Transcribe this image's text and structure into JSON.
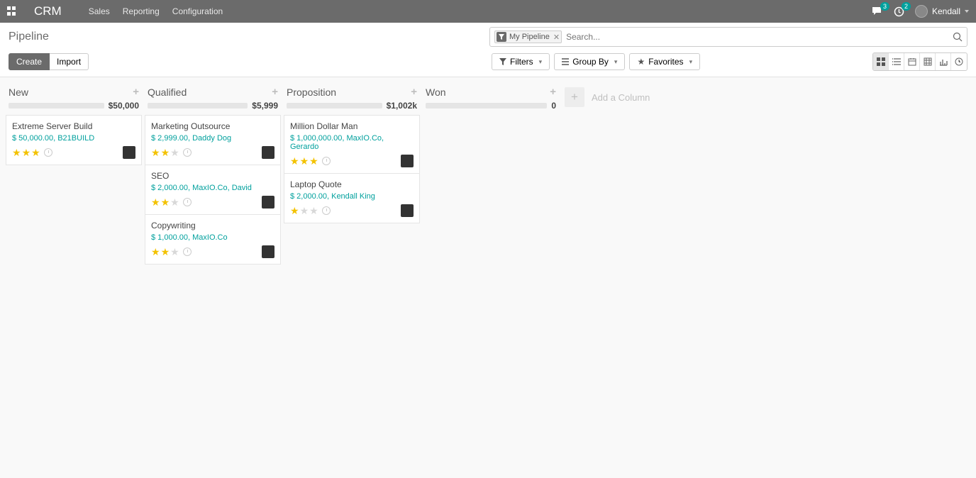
{
  "nav": {
    "brand": "CRM",
    "links": [
      "Sales",
      "Reporting",
      "Configuration"
    ],
    "msg_badge": "3",
    "activity_badge": "2",
    "user_name": "Kendall"
  },
  "breadcrumb": "Pipeline",
  "search": {
    "facet_label": "My Pipeline",
    "placeholder": "Search..."
  },
  "toolbar": {
    "create": "Create",
    "import": "Import",
    "filters": "Filters",
    "groupby": "Group By",
    "favorites": "Favorites"
  },
  "add_column": "Add a Column",
  "columns": [
    {
      "title": "New",
      "total": "$50,000",
      "cards": [
        {
          "title": "Extreme Server Build",
          "sub": "$ 50,000.00, B21BUILD",
          "stars": 3
        }
      ]
    },
    {
      "title": "Qualified",
      "total": "$5,999",
      "cards": [
        {
          "title": "Marketing Outsource",
          "sub": "$ 2,999.00, Daddy Dog",
          "stars": 2
        },
        {
          "title": "SEO",
          "sub": "$ 2,000.00, MaxIO.Co, David",
          "stars": 2
        },
        {
          "title": "Copywriting",
          "sub": "$ 1,000.00, MaxIO.Co",
          "stars": 2
        }
      ]
    },
    {
      "title": "Proposition",
      "total": "$1,002k",
      "cards": [
        {
          "title": "Million Dollar Man",
          "sub": "$ 1,000,000.00, MaxIO.Co, Gerardo",
          "stars": 3
        },
        {
          "title": "Laptop Quote",
          "sub": "$ 2,000.00, Kendall King",
          "stars": 1
        }
      ]
    },
    {
      "title": "Won",
      "total": "0",
      "cards": []
    }
  ]
}
